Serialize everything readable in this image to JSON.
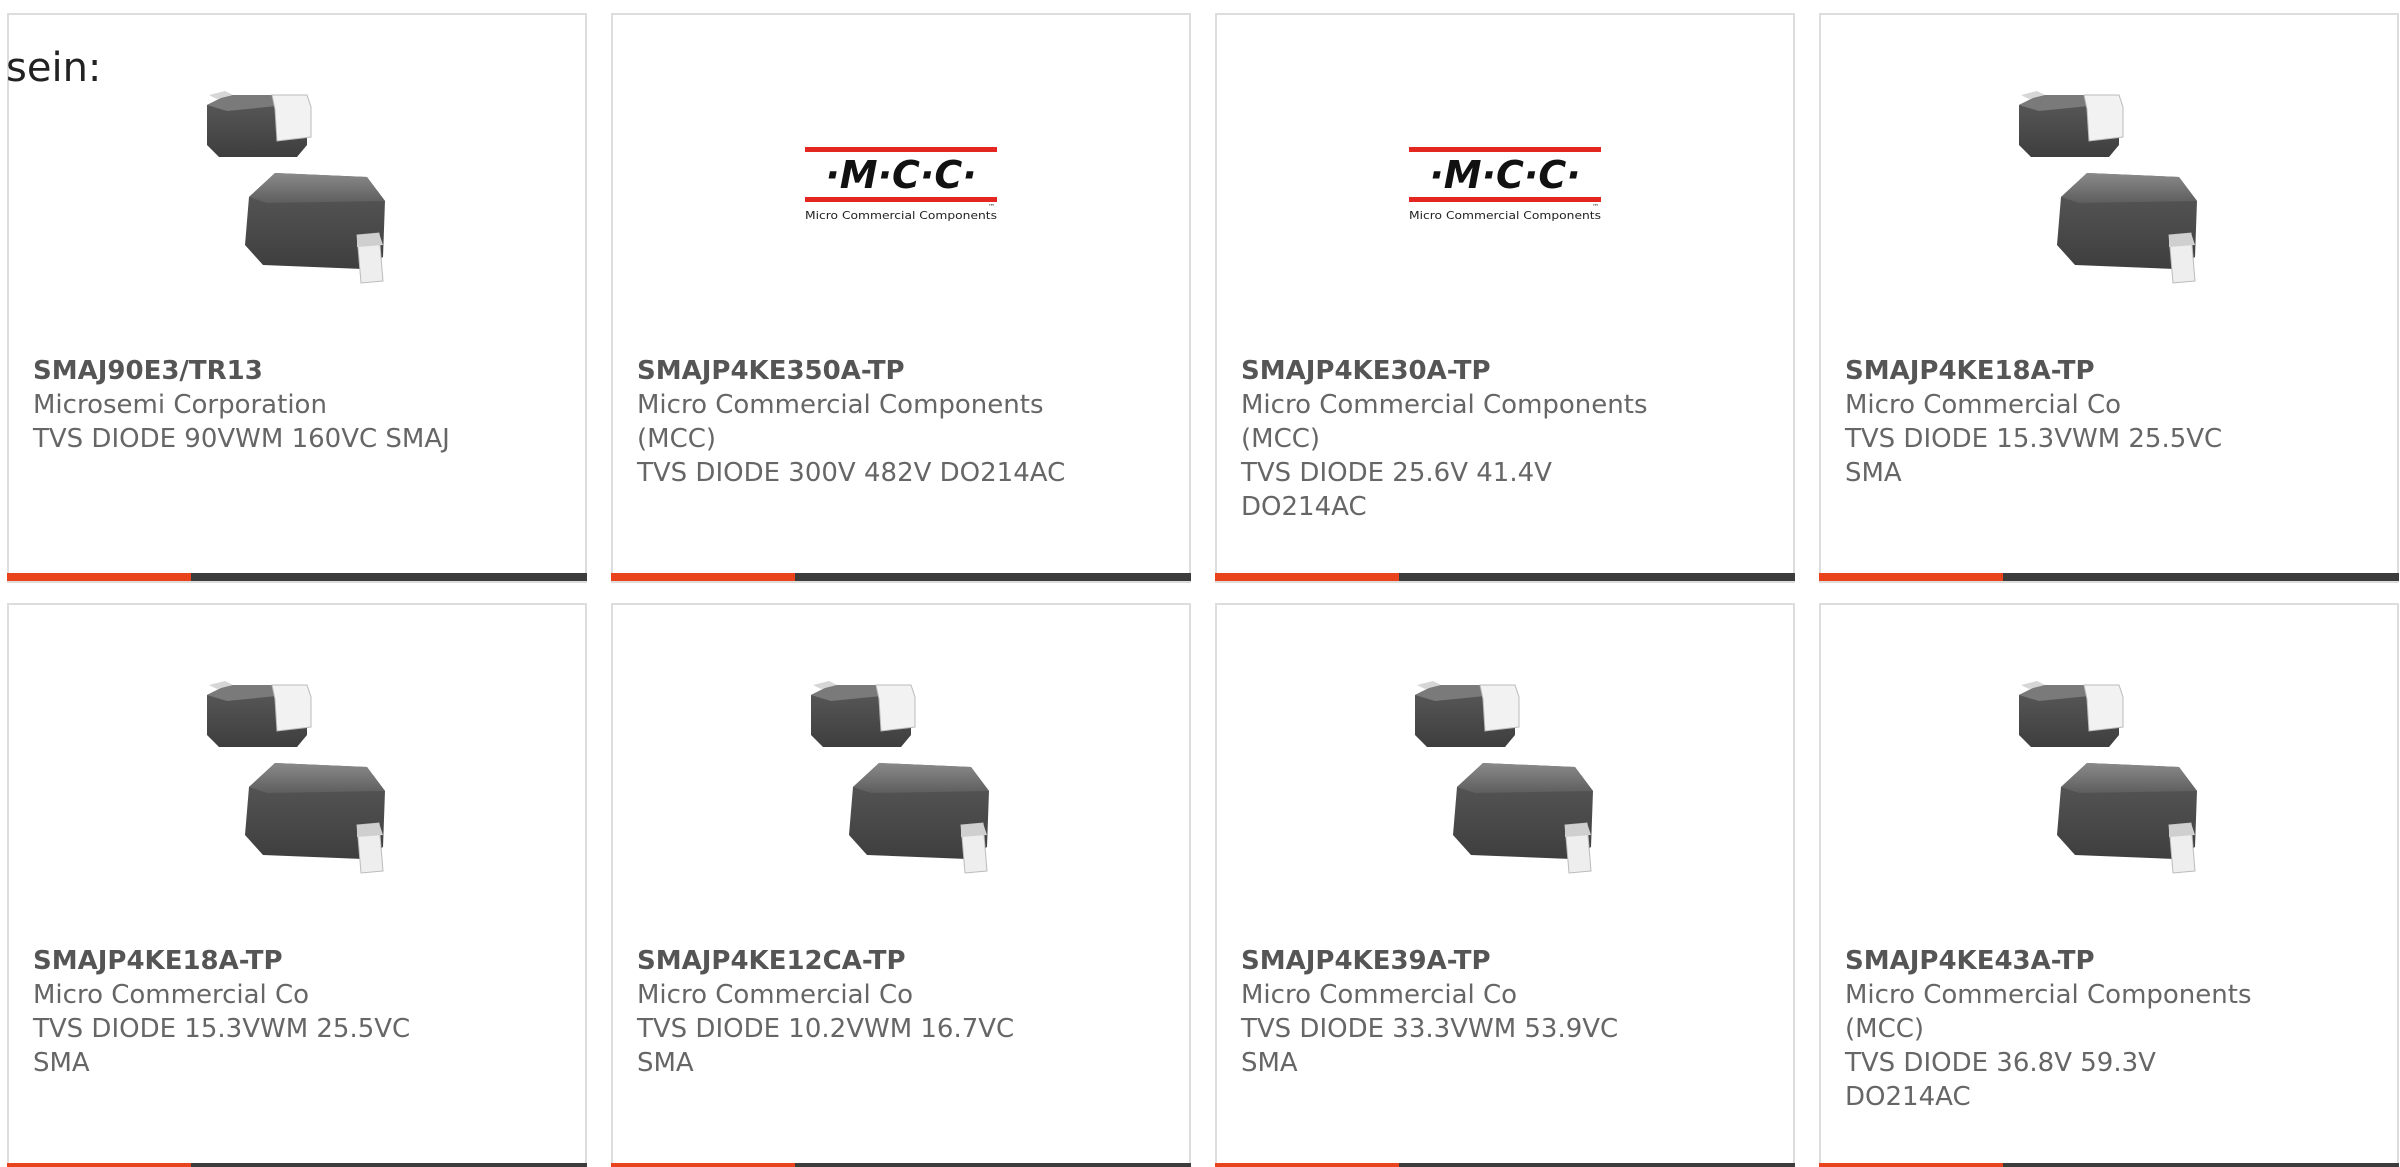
{
  "intro_text": "sein:",
  "colors": {
    "bar_accent": "#e8431a",
    "bar_rest": "#3c3c3c",
    "mcc_red": "#e3261f"
  },
  "mcc_logo": {
    "letters": "·M·C·C·",
    "tagline": "Micro Commercial Components",
    "tm": "™"
  },
  "products": [
    {
      "part_number": "SMAJ90E3/TR13",
      "manufacturer": "Microsemi Corporation",
      "description": "TVS DIODE 90VWM 160VC SMAJ",
      "image": "diode-package-icon"
    },
    {
      "part_number": "SMAJP4KE350A-TP",
      "manufacturer": "Micro Commercial Components (MCC)",
      "description": "TVS DIODE 300V 482V DO214AC",
      "image": "mcc-logo"
    },
    {
      "part_number": "SMAJP4KE30A-TP",
      "manufacturer": "Micro Commercial Components (MCC)",
      "description": "TVS DIODE 25.6V 41.4V DO214AC",
      "image": "mcc-logo"
    },
    {
      "part_number": "SMAJP4KE18A-TP",
      "manufacturer": "Micro Commercial Co",
      "description": "TVS DIODE 15.3VWM 25.5VC SMA",
      "image": "diode-package-icon"
    },
    {
      "part_number": "SMAJP4KE18A-TP",
      "manufacturer": "Micro Commercial Co",
      "description": "TVS DIODE 15.3VWM 25.5VC SMA",
      "image": "diode-package-icon"
    },
    {
      "part_number": "SMAJP4KE12CA-TP",
      "manufacturer": "Micro Commercial Co",
      "description": "TVS DIODE 10.2VWM 16.7VC SMA",
      "image": "diode-package-icon"
    },
    {
      "part_number": "SMAJP4KE39A-TP",
      "manufacturer": "Micro Commercial Co",
      "description": "TVS DIODE 33.3VWM 53.9VC SMA",
      "image": "diode-package-icon"
    },
    {
      "part_number": "SMAJP4KE43A-TP",
      "manufacturer": "Micro Commercial Components (MCC)",
      "description": "TVS DIODE 36.8V 59.3V DO214AC",
      "image": "diode-package-icon"
    }
  ]
}
